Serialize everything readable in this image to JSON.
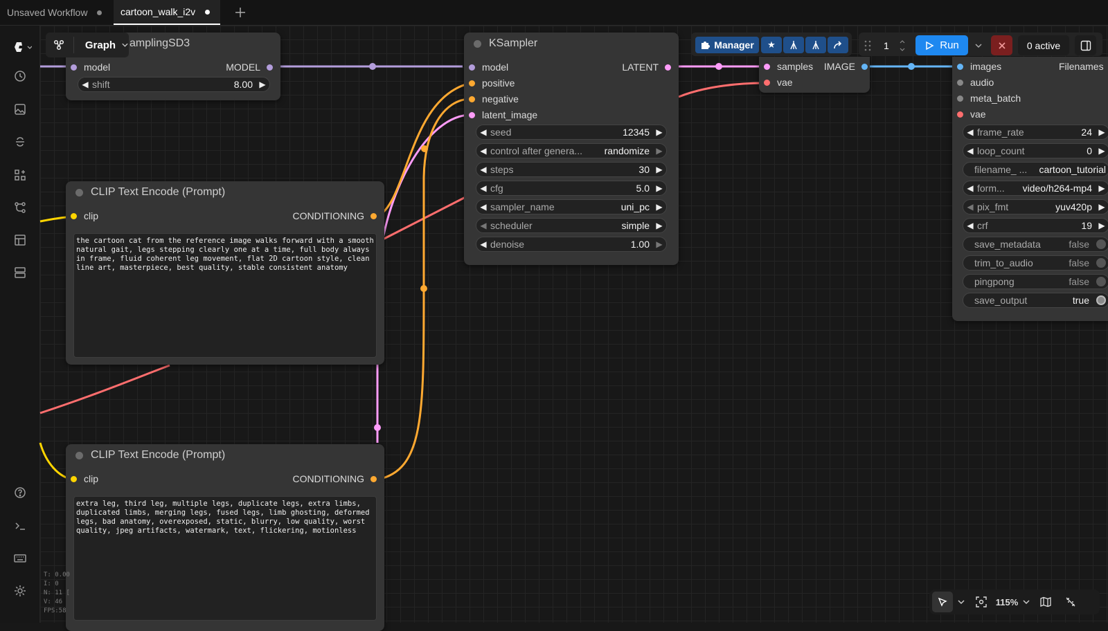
{
  "tabs": [
    {
      "label": "Unsaved Workflow",
      "active": false
    },
    {
      "label": "cartoon_walk_i2v",
      "active": true
    }
  ],
  "graph_menu": {
    "label": "Graph"
  },
  "nodes": {
    "model_sampling": {
      "title": "ModelSamplingSD3",
      "title_visible": "amplingSD3",
      "input": "model",
      "output": "MODEL",
      "widgets": [
        {
          "label": "shift",
          "value": "8.00"
        }
      ]
    },
    "ksampler": {
      "title": "KSampler",
      "inputs": [
        "model",
        "positive",
        "negative",
        "latent_image"
      ],
      "output": "LATENT",
      "widgets": [
        {
          "label": "seed",
          "value": "12345"
        },
        {
          "label": "control after genera...",
          "value": "randomize"
        },
        {
          "label": "steps",
          "value": "30"
        },
        {
          "label": "cfg",
          "value": "5.0"
        },
        {
          "label": "sampler_name",
          "value": "uni_pc"
        },
        {
          "label": "scheduler",
          "value": "simple"
        },
        {
          "label": "denoise",
          "value": "1.00"
        }
      ]
    },
    "vae_decode": {
      "inputs": [
        "samples",
        "vae"
      ],
      "output": "IMAGE"
    },
    "video_combine": {
      "inputs": [
        "images",
        "audio",
        "meta_batch",
        "vae"
      ],
      "output": "Filenames",
      "widgets": [
        {
          "label": "frame_rate",
          "value": "24"
        },
        {
          "label": "loop_count",
          "value": "0"
        },
        {
          "label": "filename_ ...",
          "value": "cartoon_tutorial"
        },
        {
          "label": "form...",
          "value": "video/h264-mp4"
        },
        {
          "label": "pix_fmt",
          "value": "yuv420p"
        },
        {
          "label": "crf",
          "value": "19"
        },
        {
          "label": "save_metadata",
          "value": "false"
        },
        {
          "label": "trim_to_audio",
          "value": "false"
        },
        {
          "label": "pingpong",
          "value": "false"
        },
        {
          "label": "save_output",
          "value": "true"
        }
      ]
    },
    "clip_positive": {
      "title": "CLIP Text Encode (Prompt)",
      "input": "clip",
      "output": "CONDITIONING",
      "text": "the cartoon cat from the reference image walks forward with a smooth natural gait, legs stepping clearly one at a time, full body always in frame, fluid coherent leg movement, flat 2D cartoon style, clean line art, masterpiece, best quality, stable consistent anatomy"
    },
    "clip_negative": {
      "title": "CLIP Text Encode (Prompt)",
      "input": "clip",
      "output": "CONDITIONING",
      "text": "extra leg, third leg, multiple legs, duplicate legs, extra limbs, duplicated limbs, merging legs, fused legs, limb ghosting, deformed legs, bad anatomy, overexposed, static, blurry, low quality, worst quality, jpeg artifacts, watermark, text, flickering, motionless"
    }
  },
  "toolbar": {
    "manager_label": "Manager",
    "queue_count": "1",
    "run_label": "Run",
    "active_label": "0 active"
  },
  "stats": [
    "T: 0.00",
    "I: 0",
    "N: 11 [",
    "V: 46",
    "FPS:58"
  ],
  "zoom": "115%",
  "colors": {
    "model": "#b39ddb",
    "latent": "#ff9cf9",
    "conditioning": "#ffa931",
    "clip": "#ffd500",
    "vae": "#ff6e6e",
    "image": "#64b5f6",
    "run": "#1e88f0",
    "manager": "#1f4f8a"
  }
}
